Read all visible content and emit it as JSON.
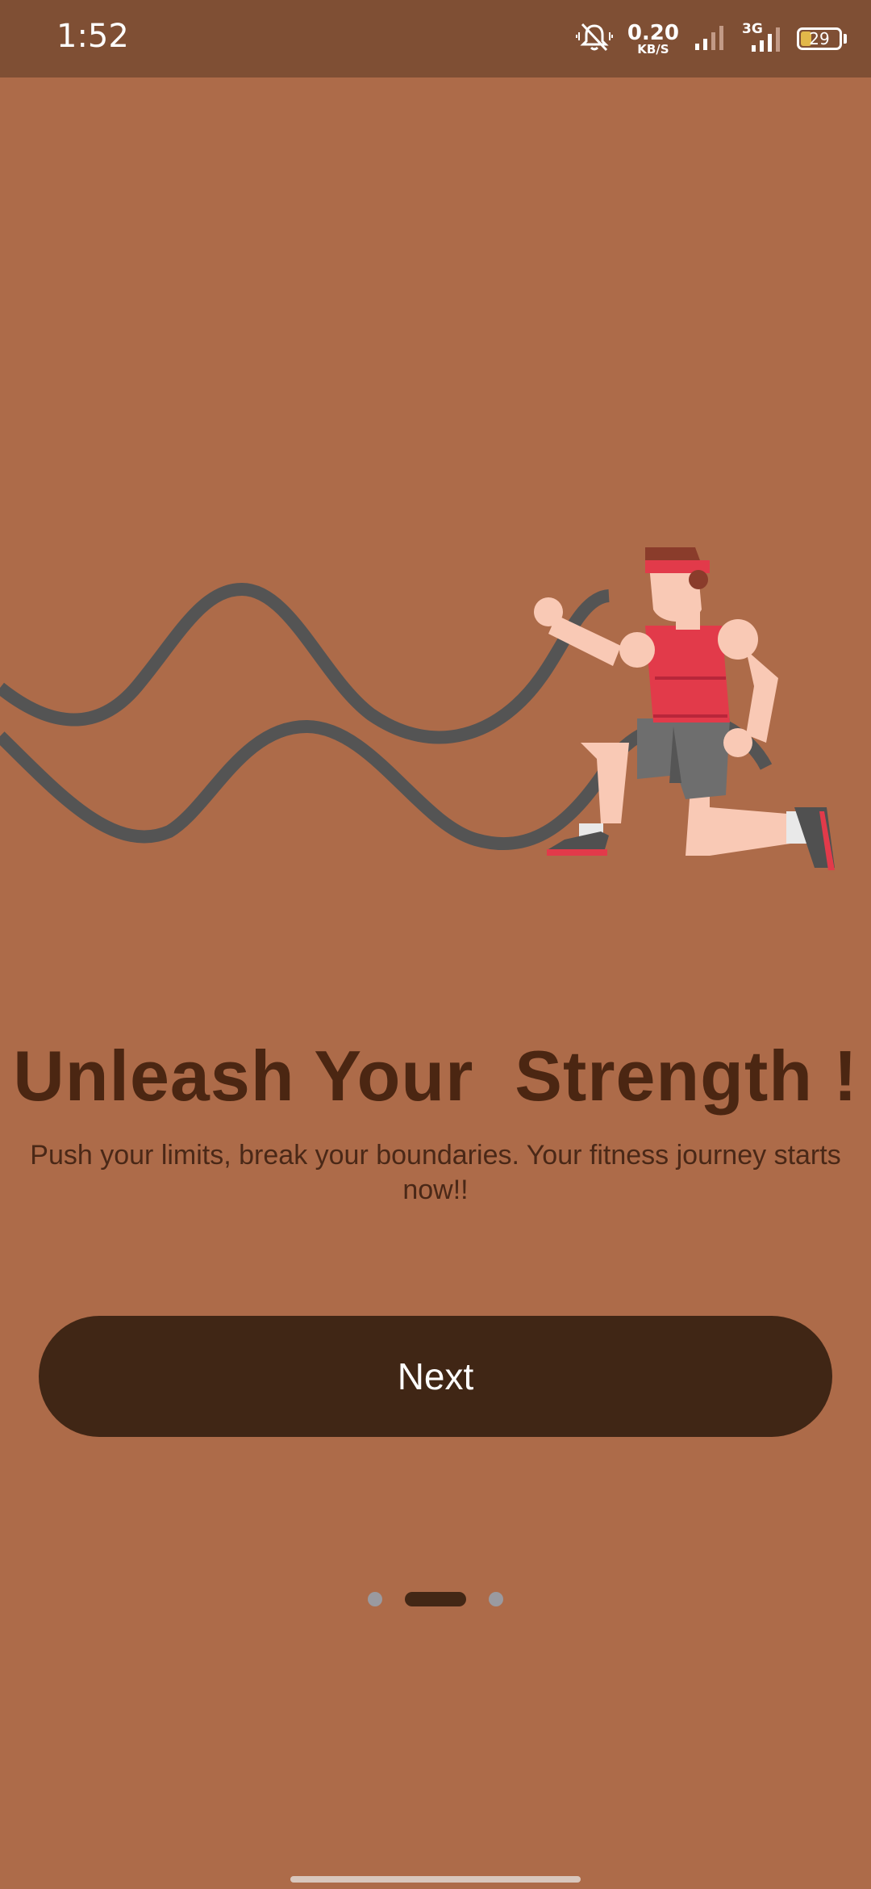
{
  "status_bar": {
    "time": "1:52",
    "speed_value": "0.20",
    "speed_unit": "KB/S",
    "network": "3G",
    "battery": "29",
    "battery_level": 0.29,
    "icons": [
      "bell-off-icon",
      "signal-icon",
      "signal-3g-icon",
      "battery-icon"
    ]
  },
  "illustration": {
    "icon": "battle-ropes-athlete-illustration"
  },
  "onboarding": {
    "title": "Unleash Your  Strength !",
    "subtitle": "Push your limits, break your boundaries. Your fitness journey starts now!!",
    "next_label": "Next"
  },
  "pager": {
    "count": 3,
    "active_index": 1
  },
  "colors": {
    "background": "#ad6b49",
    "status_bar": "#7f4f34",
    "title": "#4b2612",
    "button": "#402615",
    "dot_inactive": "#9a9aa0",
    "dot_active": "#432715"
  }
}
